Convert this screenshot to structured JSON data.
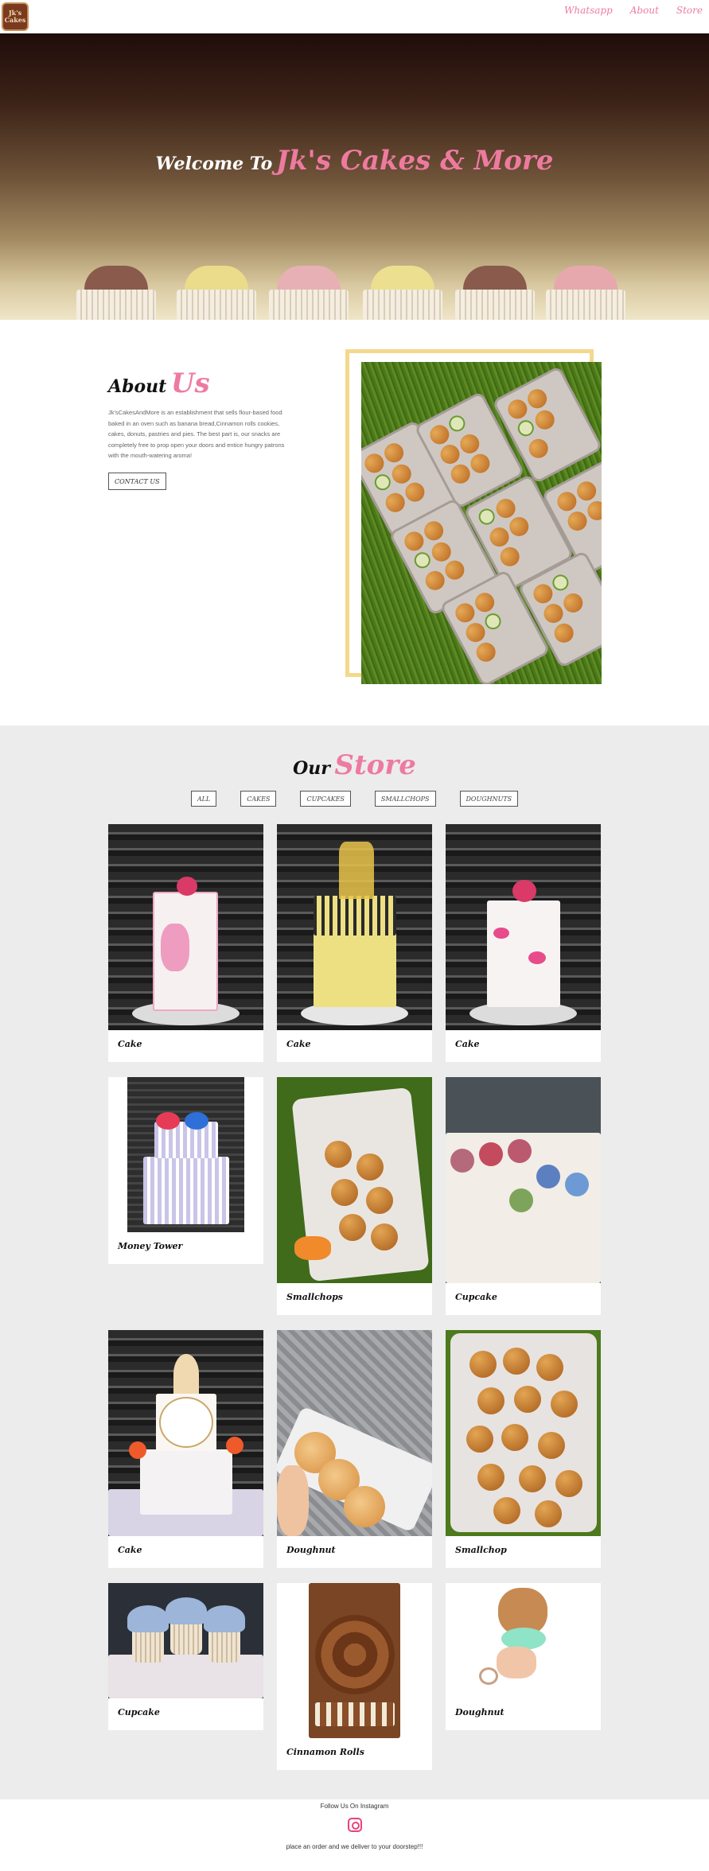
{
  "nav": {
    "logo_text": "Jk's Cakes",
    "links": [
      "Whatsapp",
      "About",
      "Store"
    ]
  },
  "hero": {
    "welcome": "Welcome To",
    "brand": "Jk's Cakes & More"
  },
  "about": {
    "heading_prefix": "About",
    "heading_accent": "Us",
    "text": "Jk'sCakesAndMore is an establishment that sells flour-based food baked in an oven such as banana bread,Cinnamon rolls cookies, cakes, donuts, pastries and pies. The best part is, our snacks are completely free to prop open your doors and entice hungry patrons with the mouth-watering aroma!",
    "button": "CONTACT US"
  },
  "store": {
    "heading_prefix": "Our",
    "heading_accent": "Store",
    "filters": [
      "ALL",
      "CAKES",
      "CUPCAKES",
      "SMALLCHOPS",
      "DOUGHNUTS"
    ],
    "items": [
      {
        "label": "Cake"
      },
      {
        "label": "Cake"
      },
      {
        "label": "Cake"
      },
      {
        "label": "Money Tower"
      },
      {
        "label": "Smallchops"
      },
      {
        "label": "Cupcake"
      },
      {
        "label": "Cake"
      },
      {
        "label": "Doughnut"
      },
      {
        "label": "Smallchop"
      },
      {
        "label": "Cupcake"
      },
      {
        "label": "Cinnamon Rolls"
      },
      {
        "label": "Doughnut"
      }
    ]
  },
  "footer": {
    "follow": "Follow Us On Instagram",
    "icon": "instagram-icon",
    "deliver": "place an order and we deliver to your doorstep!!!"
  },
  "colors": {
    "accent_pink": "#ee7aa0",
    "frame_yellow": "#f4d88c",
    "store_bg": "#ececec"
  }
}
